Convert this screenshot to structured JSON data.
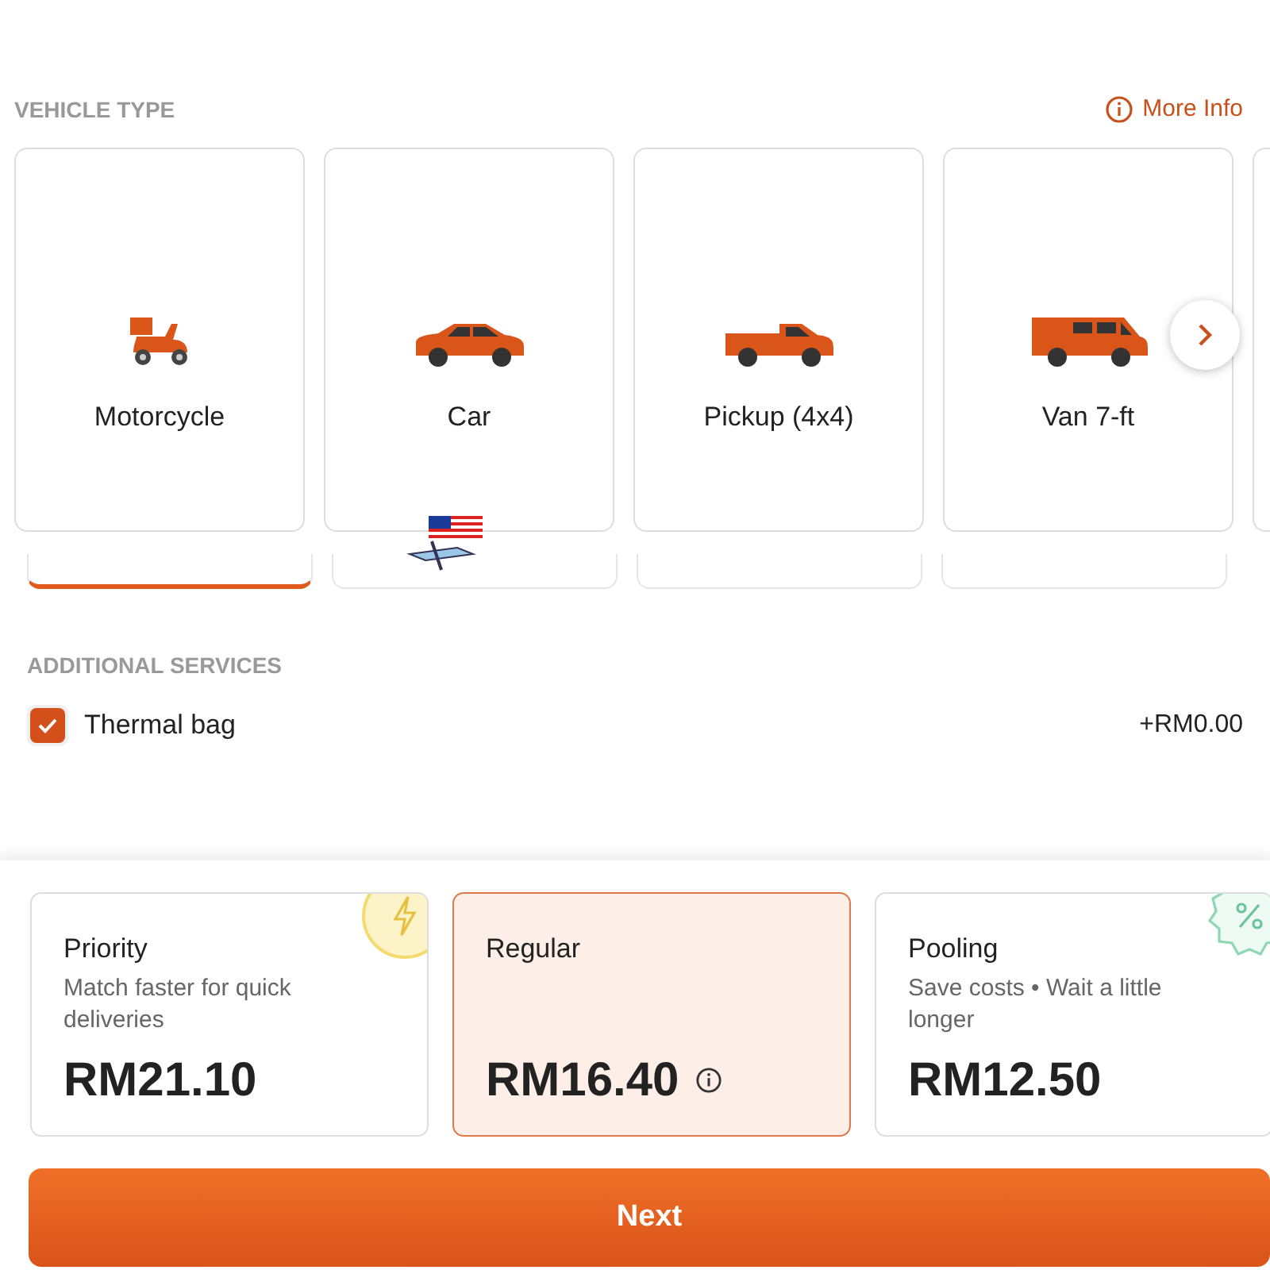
{
  "vehicle_section": {
    "title": "VEHICLE TYPE",
    "more_info": "More Info"
  },
  "vehicles": [
    {
      "name": "Motorcycle",
      "kind": "motorcycle",
      "selected": true
    },
    {
      "name": "Car",
      "kind": "car",
      "selected": false
    },
    {
      "name": "Pickup (4x4)",
      "kind": "pickup",
      "selected": false
    },
    {
      "name": "Van 7-ft",
      "kind": "van",
      "selected": false
    }
  ],
  "additional_services": {
    "title": "ADDITIONAL SERVICES",
    "items": [
      {
        "label": "Thermal bag",
        "price": "+RM0.00",
        "checked": true
      }
    ]
  },
  "options": [
    {
      "name": "Priority",
      "description": "Match faster for quick deliveries",
      "price": "RM21.10",
      "kind": "priority",
      "selected": false
    },
    {
      "name": "Regular",
      "kind": "regular",
      "price": "RM16.40",
      "info": true,
      "selected": true
    },
    {
      "name": "Pooling",
      "description": "Save costs • Wait a little longer",
      "price": "RM12.50",
      "kind": "pooling",
      "selected": false
    }
  ],
  "next_button": "Next"
}
